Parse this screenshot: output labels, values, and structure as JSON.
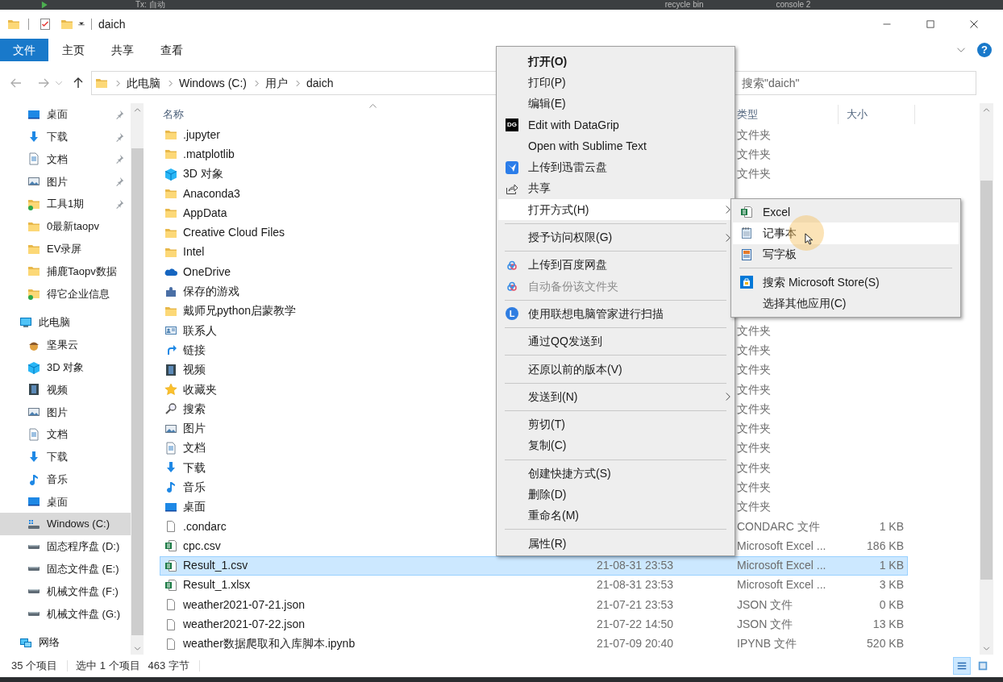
{
  "ide_bar": {
    "items": [
      "Tx: 自动",
      "recycle bin",
      "console 2"
    ]
  },
  "window": {
    "title": "daich"
  },
  "ribbon": {
    "file_button": "文件",
    "tabs": [
      "主页",
      "共享",
      "查看"
    ],
    "help": "?"
  },
  "address": {
    "crumbs": [
      "此电脑",
      "Windows (C:)",
      "用户",
      "daich"
    ],
    "search_placeholder": "搜索\"daich\""
  },
  "nav": {
    "quick_access": [
      {
        "kind": "desktop",
        "label": "桌面",
        "pinned": true
      },
      {
        "kind": "download",
        "label": "下载",
        "pinned": true
      },
      {
        "kind": "document",
        "label": "文档",
        "pinned": true
      },
      {
        "kind": "picture",
        "label": "图片",
        "pinned": true
      },
      {
        "kind": "folder_synced",
        "label": "工具1期",
        "pinned": true
      },
      {
        "kind": "folder",
        "label": "0最新taopv",
        "pinned": false
      },
      {
        "kind": "folder",
        "label": "EV录屏",
        "pinned": false
      },
      {
        "kind": "folder",
        "label": "捕鹿Taopv数据",
        "pinned": false
      },
      {
        "kind": "folder_synced",
        "label": "得它企业信息",
        "pinned": false
      }
    ],
    "tree": [
      {
        "kind": "pc",
        "label": "此电脑",
        "selected": false,
        "children": [
          {
            "kind": "acorn",
            "label": "坚果云",
            "selected": false
          },
          {
            "kind": "cube",
            "label": "3D 对象",
            "selected": false
          },
          {
            "kind": "video",
            "label": "视频",
            "selected": false
          },
          {
            "kind": "picture",
            "label": "图片",
            "selected": false
          },
          {
            "kind": "document",
            "label": "文档",
            "selected": false
          },
          {
            "kind": "download",
            "label": "下载",
            "selected": false
          },
          {
            "kind": "music",
            "label": "音乐",
            "selected": false
          },
          {
            "kind": "desktop",
            "label": "桌面",
            "selected": false
          },
          {
            "kind": "drive_win",
            "label": "Windows (C:)",
            "selected": true
          },
          {
            "kind": "drive",
            "label": "固态程序盘 (D:)",
            "selected": false
          },
          {
            "kind": "drive",
            "label": "固态文件盘 (E:)",
            "selected": false
          },
          {
            "kind": "drive",
            "label": "机械文件盘 (F:)",
            "selected": false
          },
          {
            "kind": "drive",
            "label": "机械文件盘 (G:)",
            "selected": false
          }
        ]
      },
      {
        "kind": "network",
        "label": "网络",
        "selected": false
      }
    ]
  },
  "columns": {
    "name": "名称",
    "type": "类型",
    "size": "大小"
  },
  "files": [
    {
      "kind": "folder",
      "name": ".jupyter",
      "type": "文件夹",
      "selected": false
    },
    {
      "kind": "folder",
      "name": ".matplotlib",
      "type": "文件夹",
      "selected": false
    },
    {
      "kind": "cube",
      "name": "3D 对象",
      "type": "文件夹",
      "selected": false
    },
    {
      "kind": "folder",
      "name": "Anaconda3",
      "selected": false
    },
    {
      "kind": "folder",
      "name": "AppData",
      "selected": false
    },
    {
      "kind": "folder",
      "name": "Creative Cloud Files",
      "selected": false
    },
    {
      "kind": "folder",
      "name": "Intel",
      "selected": false
    },
    {
      "kind": "onedrive",
      "name": "OneDrive",
      "selected": false
    },
    {
      "kind": "games",
      "name": "保存的游戏",
      "selected": false
    },
    {
      "kind": "folder",
      "name": "戴师兄python启蒙教学",
      "selected": false
    },
    {
      "kind": "contacts",
      "name": "联系人",
      "type": "文件夹",
      "selected": false
    },
    {
      "kind": "link",
      "name": "链接",
      "type": "文件夹",
      "selected": false
    },
    {
      "kind": "video",
      "name": "视频",
      "type": "文件夹",
      "selected": false
    },
    {
      "kind": "star",
      "name": "收藏夹",
      "type": "文件夹",
      "selected": false
    },
    {
      "kind": "search",
      "name": "搜索",
      "type": "文件夹",
      "selected": false
    },
    {
      "kind": "picture",
      "name": "图片",
      "type": "文件夹",
      "selected": false
    },
    {
      "kind": "document",
      "name": "文档",
      "type": "文件夹",
      "selected": false
    },
    {
      "kind": "download",
      "name": "下载",
      "type": "文件夹",
      "selected": false
    },
    {
      "kind": "music",
      "name": "音乐",
      "type": "文件夹",
      "selected": false
    },
    {
      "kind": "desktop",
      "name": "桌面",
      "type": "文件夹",
      "selected": false
    },
    {
      "kind": "file",
      "name": ".condarc",
      "type": "CONDARC 文件",
      "size": "1 KB",
      "selected": false
    },
    {
      "kind": "excel",
      "name": "cpc.csv",
      "type": "Microsoft Excel ...",
      "size": "186 KB",
      "selected": false
    },
    {
      "kind": "excel",
      "name": "Result_1.csv",
      "date": "21-08-31 23:53",
      "type": "Microsoft Excel ...",
      "size": "1 KB",
      "selected": true
    },
    {
      "kind": "excel",
      "name": "Result_1.xlsx",
      "date": "21-08-31 23:53",
      "type": "Microsoft Excel ...",
      "size": "3 KB",
      "selected": false
    },
    {
      "kind": "file",
      "name": "weather2021-07-21.json",
      "date": "21-07-21 23:53",
      "type": "JSON 文件",
      "size": "0 KB",
      "selected": false
    },
    {
      "kind": "file",
      "name": "weather2021-07-22.json",
      "date": "21-07-22 14:50",
      "type": "JSON 文件",
      "size": "13 KB",
      "selected": false
    },
    {
      "kind": "file",
      "name": "weather数据爬取和入库脚本.ipynb",
      "date": "21-07-09 20:40",
      "type": "IPYNB 文件",
      "size": "520 KB",
      "selected": false
    }
  ],
  "context_menu": [
    {
      "kind": "plain",
      "label": "打开(O)",
      "bold": true
    },
    {
      "kind": "plain",
      "label": "打印(P)"
    },
    {
      "kind": "plain",
      "label": "编辑(E)"
    },
    {
      "kind": "datagrip",
      "label": "Edit with DataGrip",
      "logo_text": "DG"
    },
    {
      "kind": "plain",
      "label": "Open with Sublime Text"
    },
    {
      "kind": "xunlei",
      "label": "上传到迅雷云盘"
    },
    {
      "kind": "share",
      "label": "共享"
    },
    {
      "kind": "plain",
      "label": "打开方式(H)",
      "submenu": true,
      "highlighted": true
    },
    {
      "kind": "separator"
    },
    {
      "kind": "plain",
      "label": "授予访问权限(G)",
      "submenu": true
    },
    {
      "kind": "separator"
    },
    {
      "kind": "baidu",
      "label": "上传到百度网盘"
    },
    {
      "kind": "baidu",
      "label": "自动备份该文件夹",
      "disabled": true
    },
    {
      "kind": "separator"
    },
    {
      "kind": "lenovo",
      "label": "使用联想电脑管家进行扫描",
      "logo_text": "L"
    },
    {
      "kind": "separator"
    },
    {
      "kind": "plain",
      "label": "通过QQ发送到"
    },
    {
      "kind": "separator"
    },
    {
      "kind": "plain",
      "label": "还原以前的版本(V)"
    },
    {
      "kind": "separator"
    },
    {
      "kind": "plain",
      "label": "发送到(N)",
      "submenu": true
    },
    {
      "kind": "separator"
    },
    {
      "kind": "plain",
      "label": "剪切(T)"
    },
    {
      "kind": "plain",
      "label": "复制(C)"
    },
    {
      "kind": "separator"
    },
    {
      "kind": "plain",
      "label": "创建快捷方式(S)"
    },
    {
      "kind": "plain",
      "label": "删除(D)"
    },
    {
      "kind": "plain",
      "label": "重命名(M)"
    },
    {
      "kind": "separator"
    },
    {
      "kind": "plain",
      "label": "属性(R)"
    }
  ],
  "open_with_menu": [
    {
      "kind": "excel",
      "label": "Excel"
    },
    {
      "kind": "notepad",
      "label": "记事本",
      "highlighted": true
    },
    {
      "kind": "wordpad",
      "label": "写字板"
    },
    {
      "kind": "separator"
    },
    {
      "kind": "store",
      "label": "搜索 Microsoft Store(S)"
    },
    {
      "kind": "plain",
      "label": "选择其他应用(C)"
    }
  ],
  "status_bar": {
    "count": "35 个项目",
    "selection": "选中 1 个项目",
    "size": "463 字节"
  }
}
